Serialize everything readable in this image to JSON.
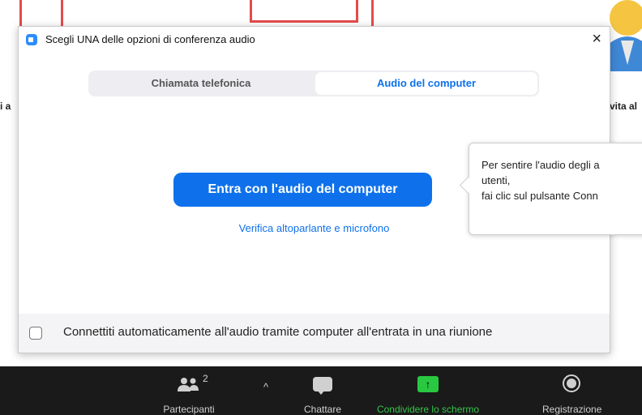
{
  "background": {
    "left_label": "i a",
    "right_label": "vita al"
  },
  "dialog": {
    "title": "Scegli UNA delle opzioni di conferenza audio",
    "close_label": "×",
    "tabs": [
      {
        "label": "Chiamata telefonica",
        "selected": false
      },
      {
        "label": "Audio del computer",
        "selected": true
      }
    ],
    "join_button_label": "Entra con l'audio del computer",
    "test_link_label": "Verifica altoparlante e microfono",
    "auto_connect_label": "Connettiti automaticamente all'audio tramite computer all'entrata in una riunione",
    "auto_connect_checked": false
  },
  "tooltip": {
    "lines": [
      "Per sentire l'audio degli a",
      "utenti,",
      "fai clic sul pulsante Conn"
    ]
  },
  "toolbar": {
    "participants_label": "Partecipanti",
    "participants_count": "2",
    "caret": "^",
    "chat_label": "Chattare",
    "share_label": "Condividere lo schermo",
    "share_arrow": "↑",
    "record_label": "Registrazione"
  },
  "colors": {
    "accent": "#0e71eb",
    "share_green": "#28c840",
    "toolbar_bg": "#1a1a1a"
  }
}
